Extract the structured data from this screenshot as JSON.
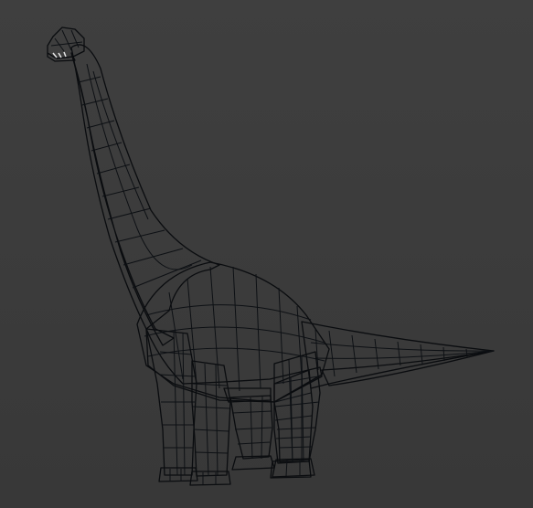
{
  "viewport": {
    "background_color": "#3c3c3c",
    "model": {
      "subject": "brachiosaurus",
      "display": "shaded-with-wireframe-edges",
      "colors": {
        "skin": "#6a7f8e",
        "skin_light": "#7f95a4",
        "skin_dark": "#4b5d6a",
        "belly": "#c9c0a0",
        "belly_shadow": "#a69e82",
        "claws": "#e6e6e6",
        "wire": "#0d1014"
      }
    }
  }
}
